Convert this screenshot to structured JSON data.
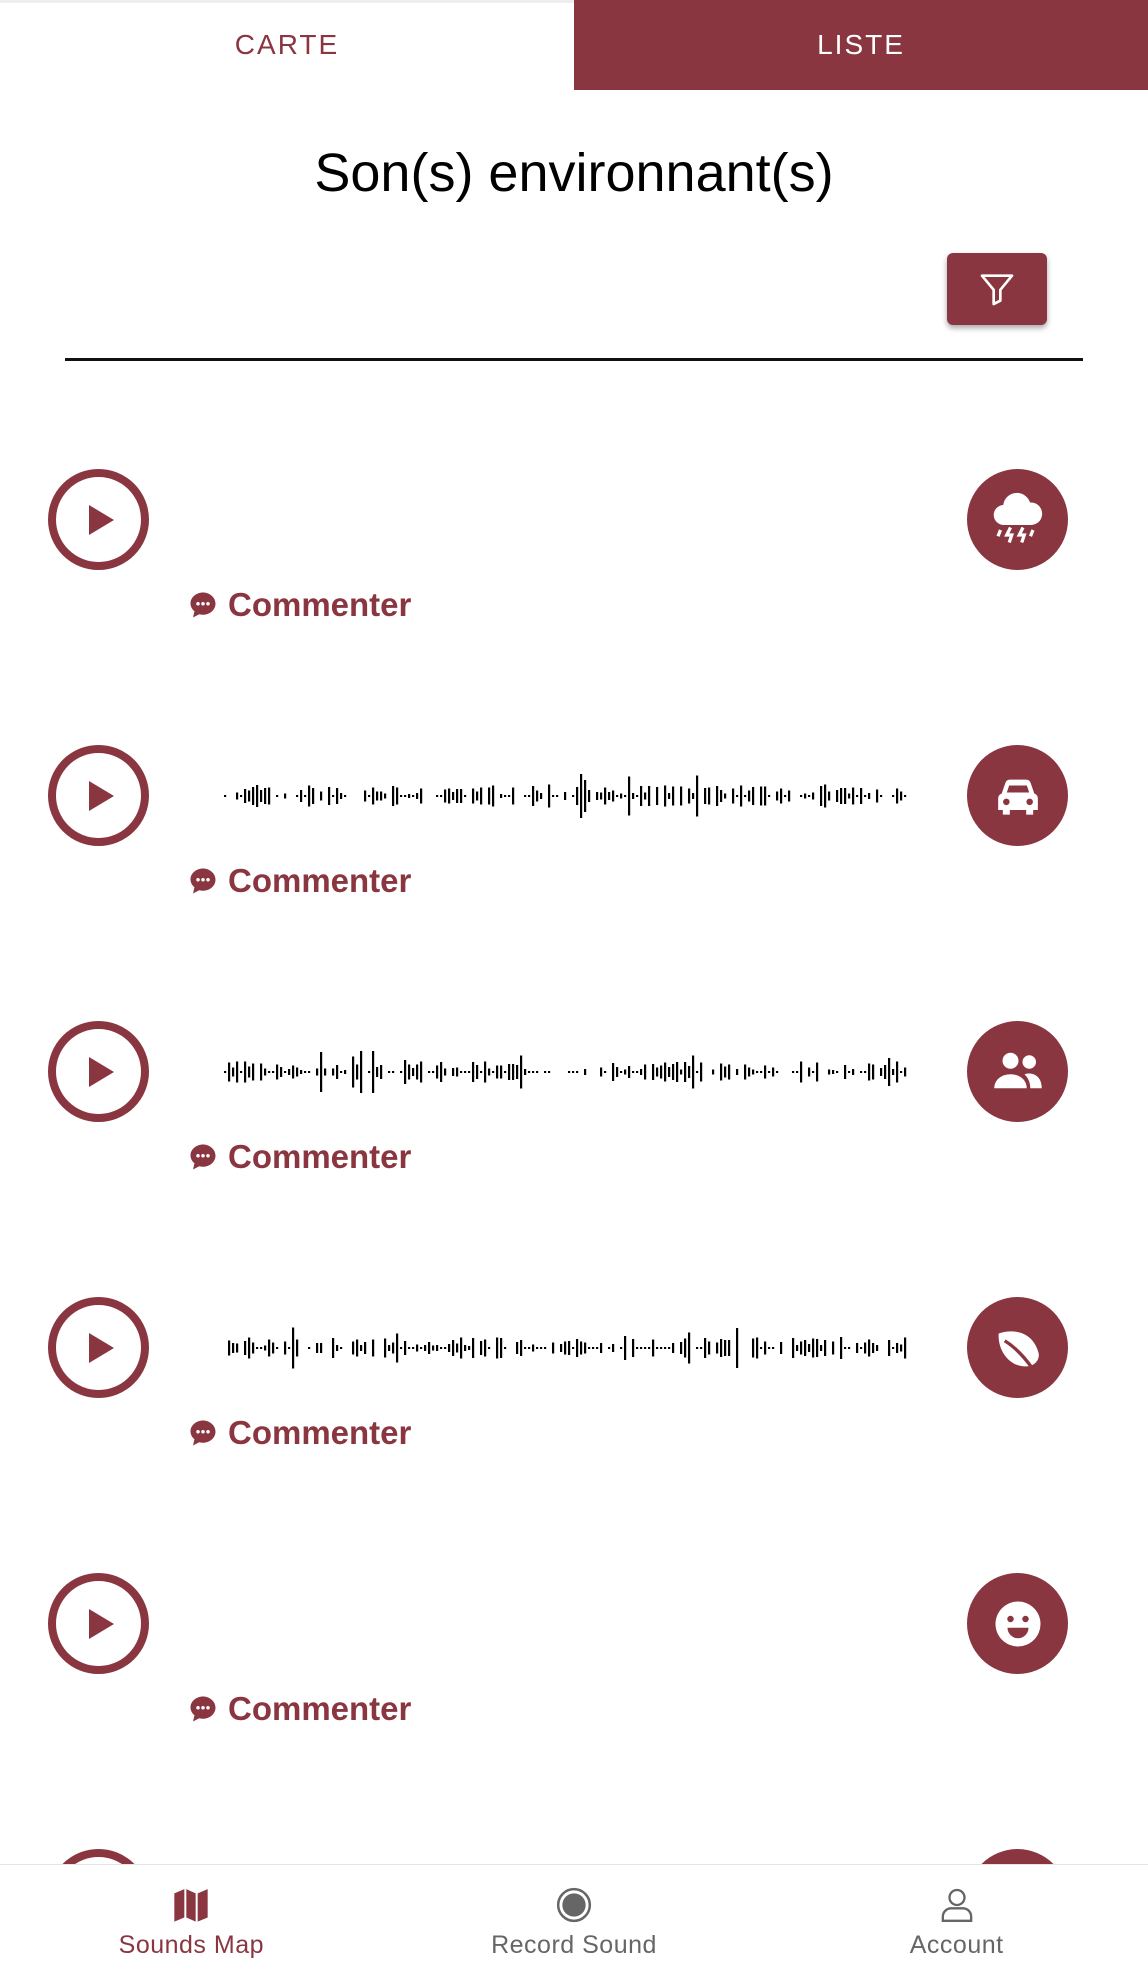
{
  "tabs": [
    {
      "label": "CARTE",
      "active": false
    },
    {
      "label": "LISTE",
      "active": true
    }
  ],
  "page_title": "Son(s) environnant(s)",
  "filter_icon": "filter-icon",
  "sounds": [
    {
      "category_icon": "storm-icon",
      "has_waveform": false,
      "comment_label": "Commenter"
    },
    {
      "category_icon": "car-icon",
      "has_waveform": true,
      "comment_label": "Commenter"
    },
    {
      "category_icon": "people-icon",
      "has_waveform": true,
      "comment_label": "Commenter"
    },
    {
      "category_icon": "leaf-icon",
      "has_waveform": true,
      "comment_label": "Commenter"
    },
    {
      "category_icon": "smiley-icon",
      "has_waveform": false,
      "comment_label": "Commenter"
    }
  ],
  "bottom_nav": [
    {
      "label": "Sounds Map",
      "icon": "map-icon",
      "active": true
    },
    {
      "label": "Record Sound",
      "icon": "record-icon",
      "active": false
    },
    {
      "label": "Account",
      "icon": "person-icon",
      "active": false
    }
  ],
  "colors": {
    "accent": "#8a3640",
    "text": "#000000",
    "muted": "#666666"
  }
}
